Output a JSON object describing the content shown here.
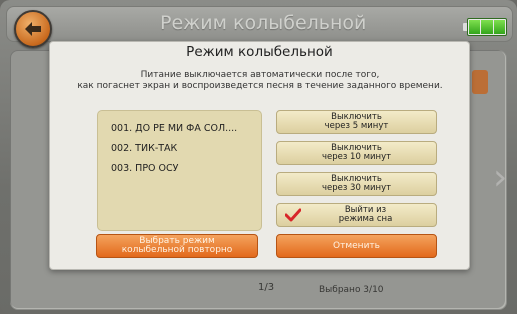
{
  "background": {
    "title": "Режим колыбельной",
    "page_indicator": "1/3",
    "selected_count": "Выбрано 3/10",
    "battery_cells": 3
  },
  "dialog": {
    "title": "Режим колыбельной",
    "description_line1": "Питание выключается автоматически после того,",
    "description_line2": "как погаснет экран и воспроизведется песня в течение заданного времени.",
    "songs": [
      "001. ДО РЕ МИ ФА СОЛ....",
      "002. ТИК-ТАК",
      "003. ПРО ОСУ"
    ],
    "buttons": {
      "off5_line1": "Выключить",
      "off5_line2": "через 5 минут",
      "off10_line1": "Выключить",
      "off10_line2": "через 10 минут",
      "off30_line1": "Выключить",
      "off30_line2": "через 30 минут",
      "exit_sleep_line1": "Выйти из",
      "exit_sleep_line2": "режима сна",
      "reselect_line1": "Выбрать режим",
      "reselect_line2": "колыбельной повторно",
      "cancel": "Отменить"
    }
  },
  "colors": {
    "accent_orange": "#e2691b",
    "check_red": "#d8262a",
    "battery_green": "#33a51b"
  },
  "icons": {
    "back": "back-arrow-icon",
    "battery": "battery-icon",
    "check": "checkmark-icon",
    "next": "chevron-right-icon"
  }
}
